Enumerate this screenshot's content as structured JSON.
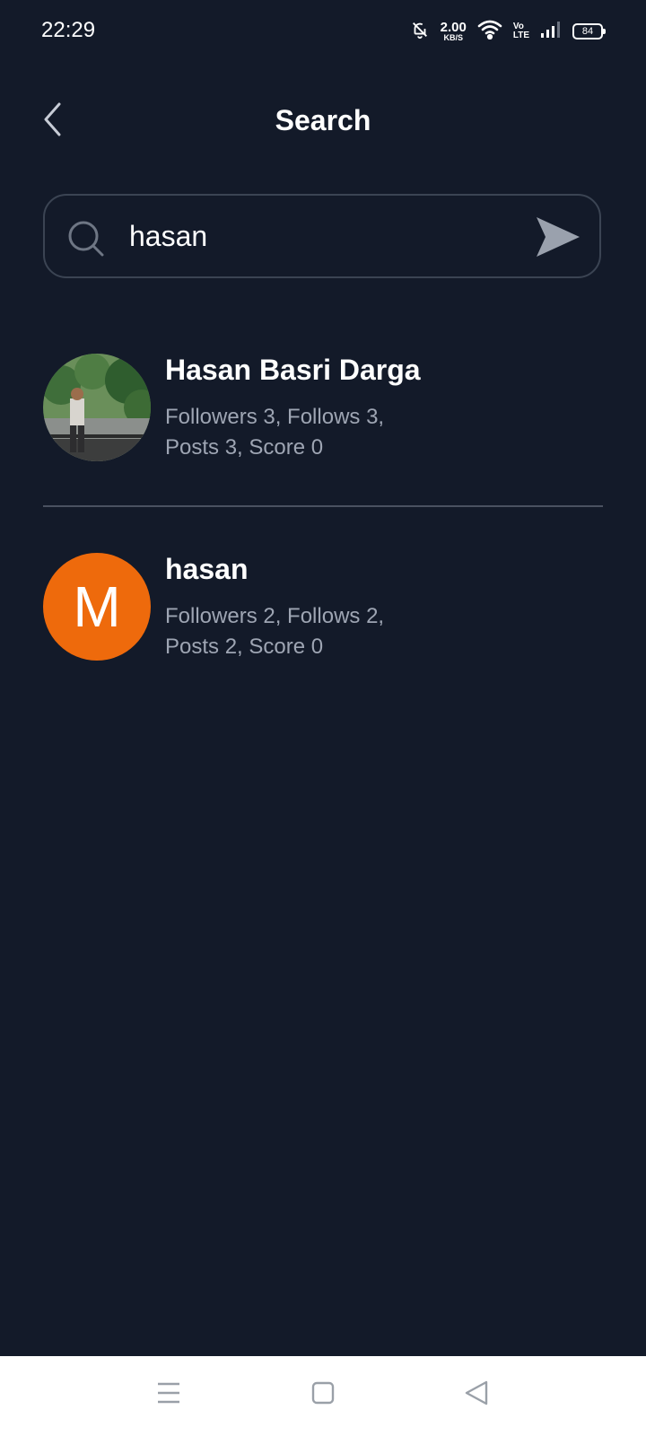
{
  "status_bar": {
    "time": "22:29",
    "net_speed_value": "2.00",
    "net_speed_unit": "KB/S",
    "volte_top": "Vo",
    "volte_bottom": "LTE",
    "battery": "84",
    "icons": [
      "bell-off-icon",
      "wifi-icon",
      "signal-icon",
      "battery-icon"
    ]
  },
  "header": {
    "title": "Search",
    "back_icon": "chevron-left-icon"
  },
  "search": {
    "value": "hasan",
    "search_icon": "search-icon",
    "send_icon": "send-icon"
  },
  "results": [
    {
      "name": "Hasan Basri Darga",
      "stats_line1": "Followers 3, Follows 3,",
      "stats_line2": "Posts 3, Score 0",
      "avatar_type": "photo"
    },
    {
      "name": "hasan",
      "stats_line1": "Followers 2, Follows 2,",
      "stats_line2": "Posts 2, Score 0",
      "avatar_letter": "M",
      "avatar_color": "#ee6a0c"
    }
  ],
  "colors": {
    "background": "#131a29",
    "muted_text": "#9ea5b3",
    "border": "#3b4453",
    "nav_background": "#ffffff"
  },
  "nav_bar": {
    "icons": [
      "menu-icon",
      "home-square-icon",
      "back-triangle-icon"
    ]
  }
}
